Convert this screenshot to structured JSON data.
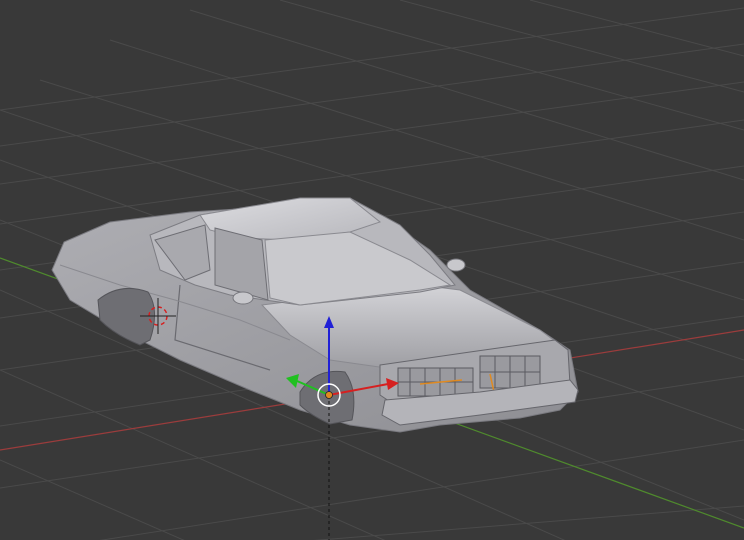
{
  "viewport": {
    "background_color": "#393939",
    "grid_color": "#4a4a4a",
    "x_axis_color": "#9b3c3c",
    "y_axis_color": "#4f8a2d",
    "object": "car-mesh",
    "object_color": "#c4c4c8",
    "gizmo": {
      "x_color": "#d62020",
      "y_color": "#20c020",
      "z_color": "#2020d6",
      "origin_color": "#e08a20"
    }
  }
}
